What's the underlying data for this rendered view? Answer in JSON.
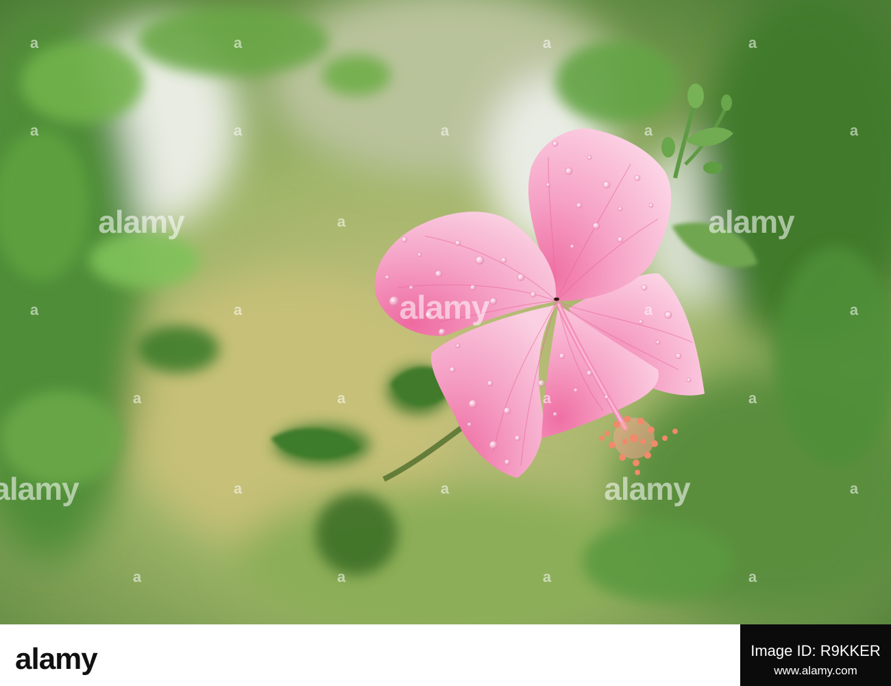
{
  "watermark": {
    "word": "alamy",
    "letter": "a"
  },
  "footer": {
    "logo": "alamy",
    "image_id": "Image ID: R9KKER",
    "url": "www.alamy.com"
  },
  "colors": {
    "petal": "#f59ac1",
    "petal_light": "#fbd3e4",
    "foliage": "#4f8a3a",
    "background_blur": "#a7b96f",
    "footer_panel": "#0b0b0b"
  }
}
